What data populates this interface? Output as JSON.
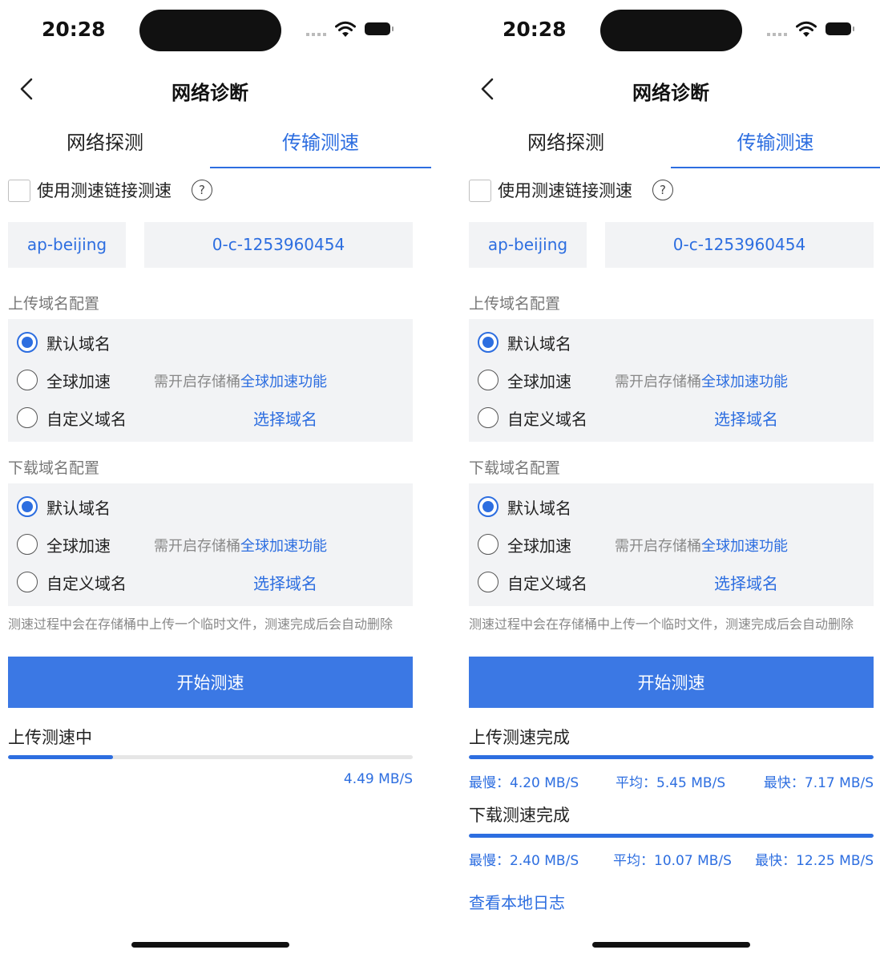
{
  "common": {
    "time": "20:28",
    "nav_title": "网络诊断",
    "tabs": [
      "网络探测",
      "传输测速"
    ],
    "checkbox_label": "使用测速链接测速",
    "help_glyph": "?",
    "region": "ap-beijing",
    "bucket": "0-c-1253960454",
    "upload_section_label": "上传域名配置",
    "download_section_label": "下载域名配置",
    "options": {
      "default": "默认域名",
      "global": "全球加速",
      "custom": "自定义域名"
    },
    "hint_prefix": "需开启存储桶",
    "hint_link": "全球加速功能",
    "choose_domain": "选择域名",
    "notice": "测速过程中会在存储桶中上传一个临时文件，测速完成后会自动删除",
    "start_button": "开始测速",
    "selected_upload_option": "default",
    "selected_download_option": "default"
  },
  "left_screen": {
    "status_title": "上传测速中",
    "progress": 0.26,
    "speed": "4.49 MB/S"
  },
  "right_screen": {
    "upload": {
      "title": "上传测速完成",
      "progress": 1.0,
      "slowest": "最慢：4.20 MB/S",
      "average": "平均：5.45 MB/S",
      "fastest": "最快：7.17 MB/S"
    },
    "download": {
      "title": "下载测速完成",
      "progress": 1.0,
      "slowest": "最慢：2.40 MB/S",
      "average": "平均：10.07 MB/S",
      "fastest": "最快：12.25 MB/S"
    },
    "log_link": "查看本地日志"
  },
  "colors": {
    "accent": "#2d6ee0",
    "button": "#3b78e4",
    "panel": "#f2f3f5"
  },
  "icons": [
    "back-chevron-icon",
    "wifi-icon",
    "battery-icon",
    "help-circle-icon",
    "radio-icon"
  ]
}
